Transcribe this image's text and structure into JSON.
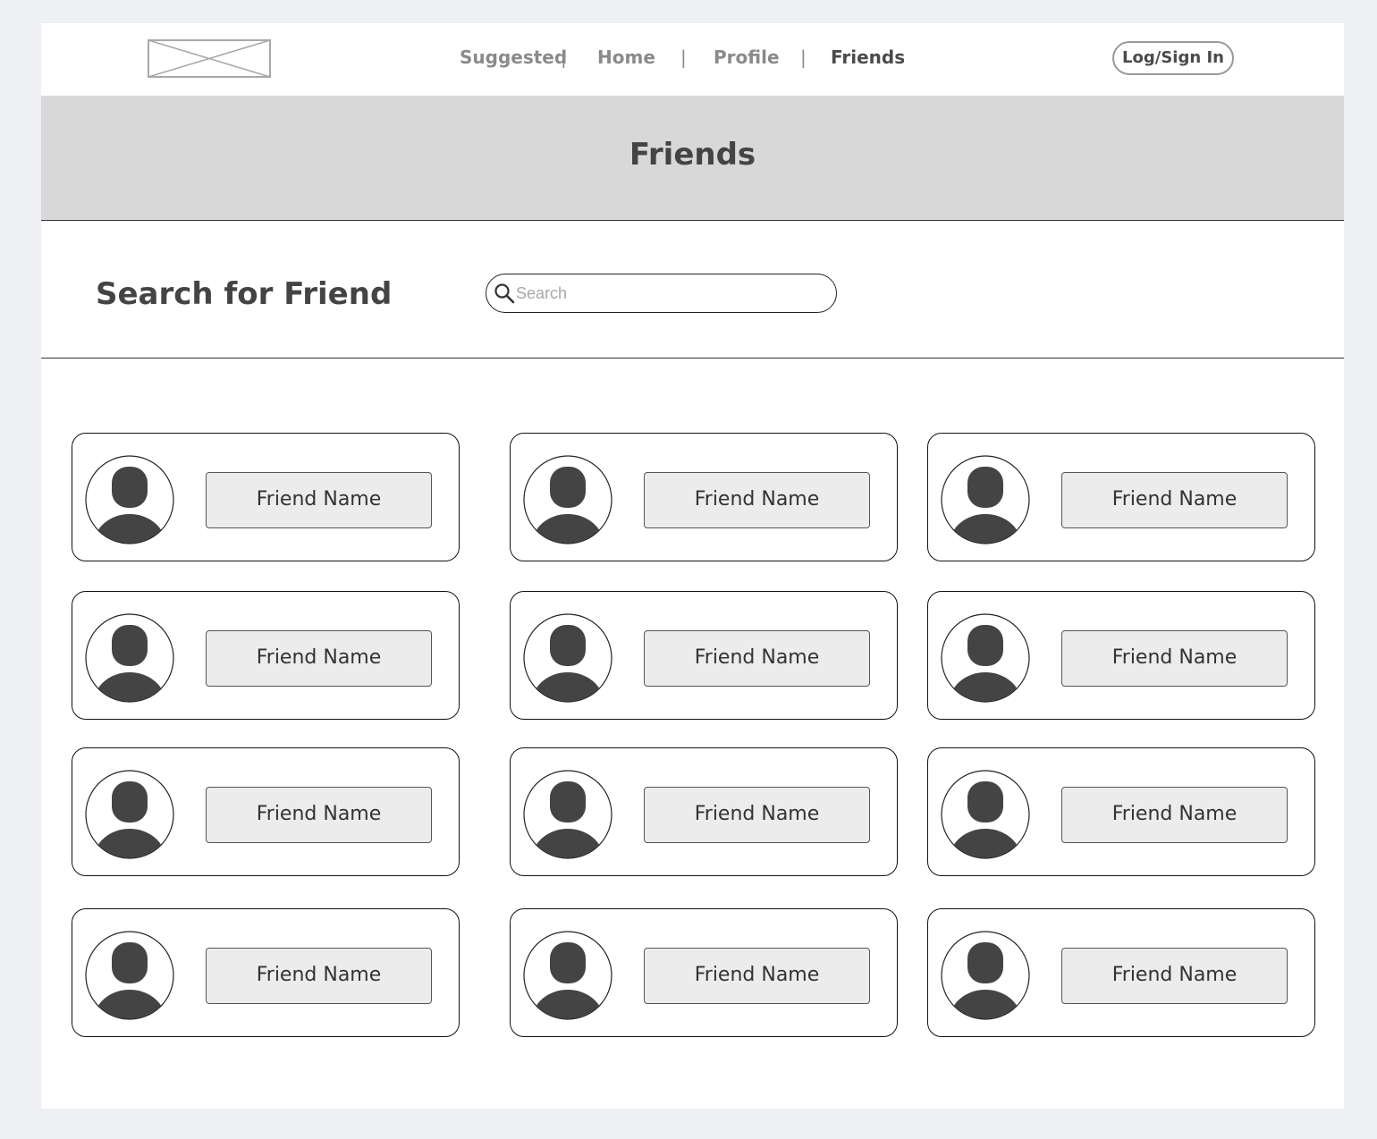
{
  "nav": {
    "items": [
      {
        "label": "Suggested",
        "active": false
      },
      {
        "label": "Home",
        "active": false
      },
      {
        "label": "Profile",
        "active": false
      },
      {
        "label": "Friends",
        "active": true
      }
    ],
    "separator": "|",
    "login_label": "Log/Sign In"
  },
  "banner": {
    "title": "Friends"
  },
  "search": {
    "label": "Search for Friend",
    "placeholder": "Search",
    "value": ""
  },
  "friends": [
    {
      "name": "Friend Name"
    },
    {
      "name": "Friend Name"
    },
    {
      "name": "Friend Name"
    },
    {
      "name": "Friend Name"
    },
    {
      "name": "Friend Name"
    },
    {
      "name": "Friend Name"
    },
    {
      "name": "Friend Name"
    },
    {
      "name": "Friend Name"
    },
    {
      "name": "Friend Name"
    },
    {
      "name": "Friend Name"
    },
    {
      "name": "Friend Name"
    },
    {
      "name": "Friend Name"
    }
  ],
  "colors": {
    "background": "#eff0f4",
    "banner": "#d8d8d8",
    "avatar": "#444444",
    "button_fill": "#ececec"
  }
}
